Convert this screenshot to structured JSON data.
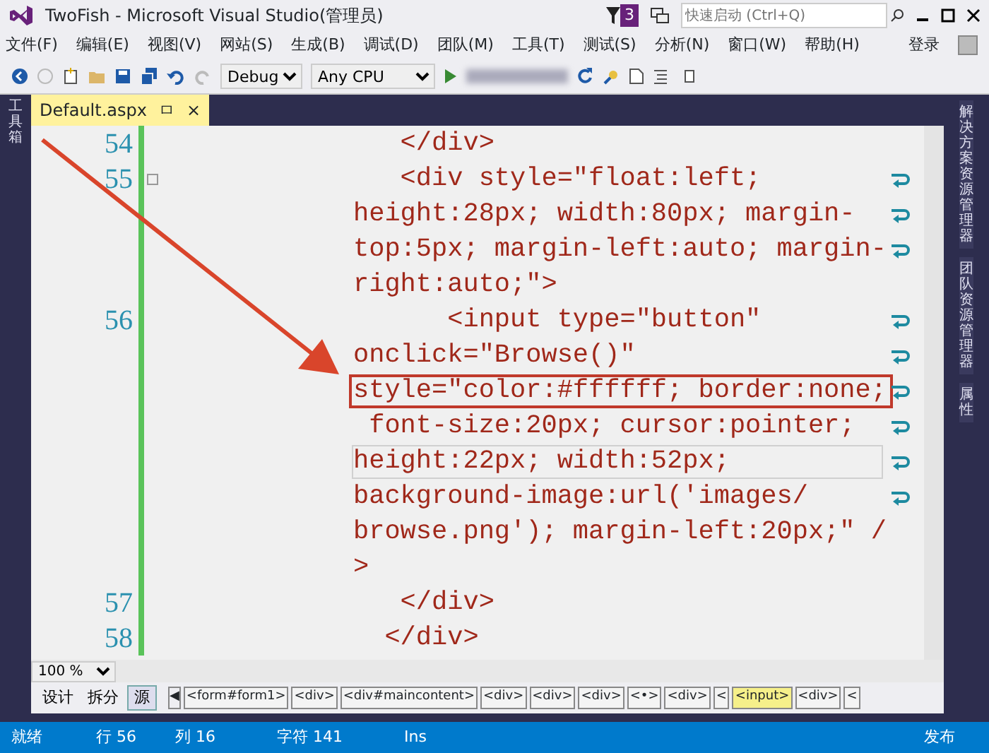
{
  "window": {
    "title": "TwoFish - Microsoft Visual Studio(管理员)",
    "notification_count": "3",
    "quick_launch": {
      "placeholder": "快速启动 (Ctrl+Q)"
    }
  },
  "menu": [
    "文件(F)",
    "编辑(E)",
    "视图(V)",
    "网站(S)",
    "生成(B)",
    "调试(D)",
    "团队(M)",
    "工具(T)",
    "测试(S)",
    "分析(N)",
    "窗口(W)",
    "帮助(H)"
  ],
  "account": "登录",
  "toolbar": {
    "configuration": "Debug",
    "platform": "Any CPU"
  },
  "left_panel": "工具箱",
  "right_panels": [
    "解决方案资源管理器",
    "团队资源管理器",
    "属性"
  ],
  "document_tab": {
    "label": "Default.aspx",
    "pin": "ㅁ",
    "close": "×"
  },
  "editor": {
    "lines": [
      {
        "number": "54",
        "text": "   </div>",
        "wrap": false,
        "fold": false,
        "current": false,
        "boxed": false
      },
      {
        "number": "55",
        "text": "   <div style=\"float:left;",
        "wrap": true,
        "fold": true,
        "current": false,
        "boxed": false
      },
      {
        "text": "height:28px; width:80px; margin-",
        "wrap": true,
        "fold": false,
        "current": false,
        "boxed": false
      },
      {
        "text": "top:5px; margin-left:auto; margin-",
        "wrap": true,
        "fold": false,
        "current": false,
        "boxed": false
      },
      {
        "text": "right:auto;\">",
        "wrap": false,
        "fold": false,
        "current": false,
        "boxed": false
      },
      {
        "number": "56",
        "text": "      <input type=\"button\"",
        "wrap": true,
        "fold": false,
        "current": false,
        "boxed": false
      },
      {
        "text": "onclick=\"Browse()\"",
        "wrap": true,
        "fold": false,
        "current": false,
        "boxed": false
      },
      {
        "text": "style=\"color:#ffffff; border:none;",
        "wrap": true,
        "fold": false,
        "current": false,
        "boxed": true
      },
      {
        "text": " font-size:20px; cursor:pointer;",
        "wrap": true,
        "fold": false,
        "current": false,
        "boxed": false
      },
      {
        "text": "height:22px; width:52px;",
        "wrap": true,
        "fold": false,
        "current": true,
        "boxed": false
      },
      {
        "text": "background-image:url('images/",
        "wrap": true,
        "fold": false,
        "current": false,
        "boxed": false
      },
      {
        "text": "browse.png'); margin-left:20px;\" /",
        "wrap": false,
        "fold": false,
        "current": false,
        "boxed": false
      },
      {
        "text": ">",
        "wrap": false,
        "fold": false,
        "current": false,
        "boxed": false
      },
      {
        "number": "57",
        "text": "   </div>",
        "wrap": false,
        "fold": false,
        "current": false,
        "boxed": false
      },
      {
        "number": "58",
        "text": "  </div>",
        "wrap": false,
        "fold": false,
        "current": false,
        "boxed": false
      }
    ]
  },
  "zoom": "100 %",
  "breadcrumb_scroll": "◀",
  "views": [
    {
      "label": "设计",
      "selected": false
    },
    {
      "label": "拆分",
      "selected": false
    },
    {
      "label": "源",
      "selected": true
    }
  ],
  "breadcrumb": [
    {
      "label": "<form#form1>",
      "selected": false
    },
    {
      "label": "<div>",
      "selected": false
    },
    {
      "label": "<div#maincontent>",
      "selected": false
    },
    {
      "label": "<div>",
      "selected": false
    },
    {
      "label": "<div>",
      "selected": false
    },
    {
      "label": "<div>",
      "selected": false
    },
    {
      "label": "<•>",
      "selected": false
    },
    {
      "label": "<div>",
      "selected": false
    },
    {
      "label": "<",
      "selected": false
    },
    {
      "label": "<input>",
      "selected": true
    },
    {
      "label": "<div>",
      "selected": false
    },
    {
      "label": "<",
      "selected": false
    }
  ],
  "status_bar": {
    "items": [
      "就绪",
      "行 56",
      "列 16",
      "字符 141",
      "Ins"
    ],
    "publish": "发布"
  }
}
